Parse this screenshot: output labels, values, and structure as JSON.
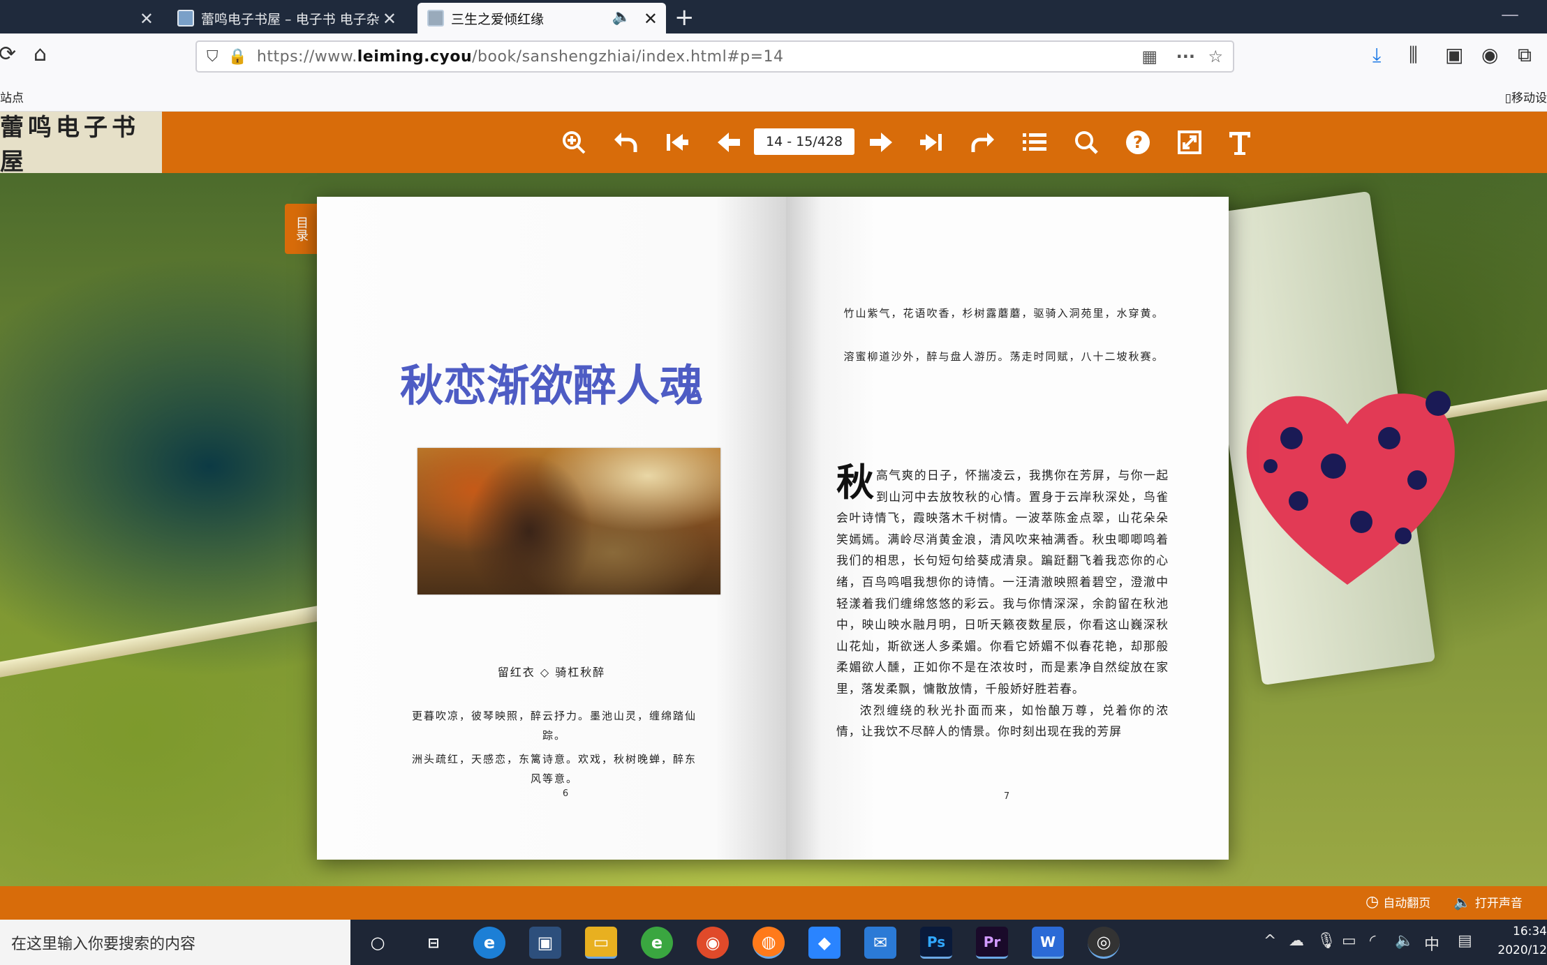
{
  "browser": {
    "tabs": [
      {
        "title": "",
        "active": false
      },
      {
        "title": "蕾鸣电子书屋 – 电子书 电子杂",
        "active": false
      },
      {
        "title": "三生之爱倾红缘",
        "active": true
      }
    ],
    "url_prefix": "https://www.",
    "url_domain": "leiming.cyou",
    "url_path": "/book/sanshengzhiai/index.html#p=14",
    "bookmark_left": "站点",
    "bookmark_right": "移动设"
  },
  "reader": {
    "logo": "蕾鸣电子书屋",
    "page_indicator": "14 - 15/428",
    "sidetab": "目录",
    "autoplay_label": "自动翻页",
    "sound_label": "打开声音"
  },
  "left_page": {
    "title": "秋恋渐欲醉人魂",
    "author": "留红衣 ◇ 骑杠秋醉",
    "poem1": "更暮吹凉，彼琴映照，醉云抒力。墨池山灵，缠绵踏仙踪。",
    "poem2": "洲头疏红，天感恋，东篱诗意。欢戏，秋树晚蝉，醉东风等意。",
    "page_number": "6"
  },
  "right_page": {
    "poem1": "竹山紫气，花语吹香，杉树露蘑蘑，驱骑入洞苑里，水穿黄。",
    "poem2": "溶蜜柳道沙外，醉与盘人游历。荡走时同赋，八十二坡秋赛。",
    "dropcap": "秋",
    "para1": "高气爽的日子，怀揣凌云，我携你在芳屏，与你一起到山河中去放牧秋的心情。置身于云岸秋深处，鸟雀会叶诗情飞，霞映落木千树情。一波萃陈金点翠，山花朵朵笑嫣嫣。满岭尽消黄金浪，清风吹来袖满香。秋虫唧唧鸣着我们的相思，长句短句给葵成清泉。蹁跹翻飞着我恋你的心绪，百鸟鸣唱我想你的诗情。一汪清澈映照着碧空，澄澈中轻漾着我们缠绵悠悠的彩云。我与你情深深，余韵留在秋池中，映山映水融月明，日听天籁夜数星辰，你看这山巍深秋山花灿，斯欲迷人多柔媚。你看它娇媚不似春花艳，却那般柔媚欲人醺，正如你不是在浓妆时，而是素净自然绽放在家里，落发柔飘，慵散放情，千般娇好胜若春。",
    "para2": "浓烈缠绕的秋光扑面而来，如怡酿万尊，兑着你的浓情，让我饮不尽醉人的情景。你时刻出现在我的芳屏",
    "page_number": "7"
  },
  "taskbar": {
    "search_placeholder": "在这里输入你要搜索的内容",
    "ime": "中",
    "time": "16:34",
    "date": "2020/12"
  }
}
